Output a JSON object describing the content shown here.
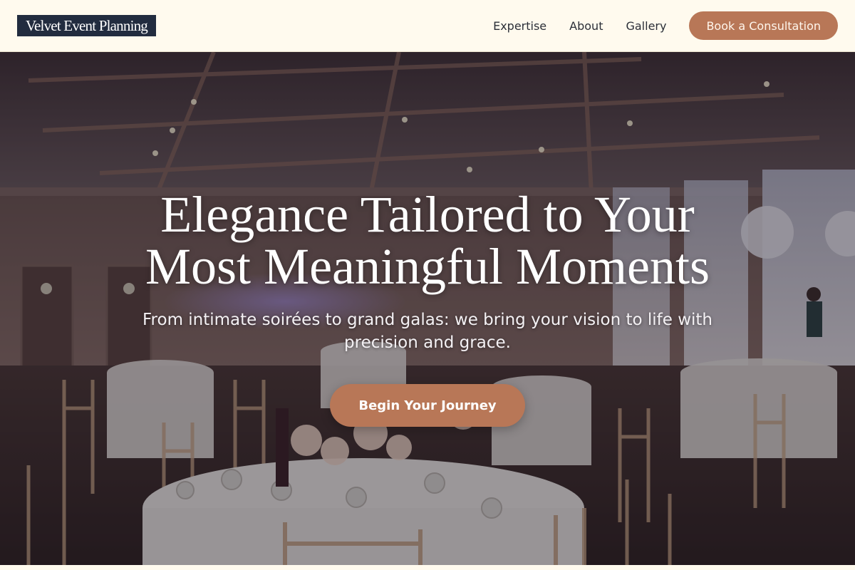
{
  "header": {
    "logo_text": "Velvet Event Planning",
    "nav": [
      "Expertise",
      "About",
      "Gallery"
    ],
    "cta_label": "Book a Consultation"
  },
  "hero": {
    "title_line1": "Elegance Tailored to Your",
    "title_line2": "Most Meaningful Moments",
    "subtitle": "From intimate soirées to grand galas: we bring your vision to life with precision and grace.",
    "cta_label": "Begin Your Journey",
    "image": "banquet-hall-photo"
  },
  "colors": {
    "background": "#fffaee",
    "logo_bg": "#222c3f",
    "accent": "#b87757",
    "nav_text": "#2b2f38"
  }
}
